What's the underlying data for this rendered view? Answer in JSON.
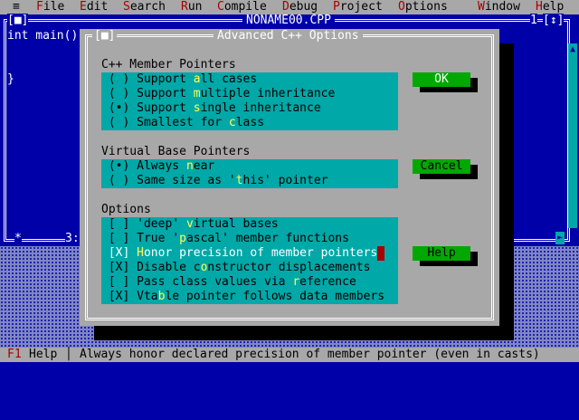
{
  "menu": {
    "system": "≡",
    "items": [
      {
        "hot": "F",
        "rest": "ile"
      },
      {
        "hot": "E",
        "rest": "dit"
      },
      {
        "hot": "S",
        "rest": "earch"
      },
      {
        "hot": "R",
        "rest": "un"
      },
      {
        "hot": "C",
        "rest": "ompile"
      },
      {
        "hot": "D",
        "rest": "ebug"
      },
      {
        "hot": "P",
        "rest": "roject"
      },
      {
        "hot": "O",
        "rest": "ptions"
      },
      {
        "hot": "W",
        "rest": "indow"
      },
      {
        "hot": "H",
        "rest": "elp"
      }
    ]
  },
  "editor": {
    "close_box": "[■]",
    "title": "NONAME00.CPP",
    "window_number": "1",
    "zoom_box": "[↕]",
    "lines": [
      "int main()",
      "",
      "",
      "}"
    ],
    "position": "3:",
    "star": "*"
  },
  "dialog": {
    "close_box": "[■]",
    "title": "Advanced C++ Options",
    "groups": [
      {
        "label": "C++ Member Pointers",
        "options": [
          {
            "mark": "( )",
            "pre": "Support ",
            "ul": "a",
            "post": "ll cases"
          },
          {
            "mark": "( )",
            "pre": "Support ",
            "ul": "m",
            "post": "ultiple inheritance"
          },
          {
            "mark": "(•)",
            "pre": "Support ",
            "ul": "s",
            "post": "ingle inheritance"
          },
          {
            "mark": "( )",
            "pre": "Smallest for ",
            "ul": "c",
            "post": "lass"
          }
        ]
      },
      {
        "label": "Virtual Base Pointers",
        "options": [
          {
            "mark": "(•)",
            "pre": "Always ",
            "ul": "n",
            "post": "ear"
          },
          {
            "mark": "( )",
            "pre": "Same size as '",
            "ul": "t",
            "post": "his' pointer"
          }
        ]
      },
      {
        "label": "Options",
        "options": [
          {
            "mark": "[ ]",
            "pre": "'deep' ",
            "ul": "v",
            "post": "irtual bases"
          },
          {
            "mark": "[ ]",
            "pre": "True '",
            "ul": "p",
            "post": "ascal' member functions"
          },
          {
            "mark": "[X]",
            "pre": "",
            "ul": "H",
            "post": "onor precision of member pointers"
          },
          {
            "mark": "[X]",
            "pre": "Disable c",
            "ul": "o",
            "post": "nstructor displacements"
          },
          {
            "mark": "[ ]",
            "pre": "Pass class values via ",
            "ul": "r",
            "post": "eference"
          },
          {
            "mark": "[X]",
            "pre": "Vta",
            "ul": "b",
            "post": "le pointer follows data members"
          }
        ]
      }
    ],
    "buttons": {
      "ok": "OK",
      "cancel": "Cancel",
      "help": "Help"
    }
  },
  "status": {
    "key": "F1",
    "key_label": "Help",
    "message": "Always honor declared precision of member pointer (even in casts)"
  }
}
